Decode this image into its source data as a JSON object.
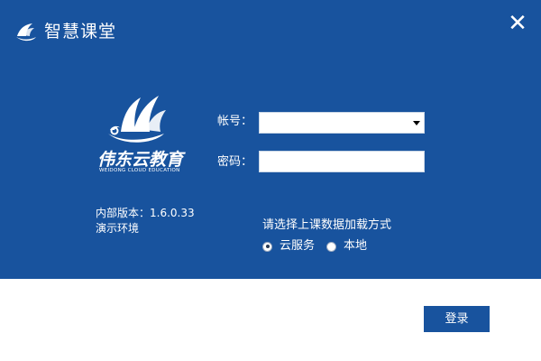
{
  "window": {
    "title": "智慧课堂",
    "close_glyph": "✕",
    "icons": {
      "app": "app-logo-icon",
      "close": "close-icon"
    }
  },
  "brand": {
    "name": "伟东云教育",
    "subtitle": "WEIDONG CLOUD EDUCATION",
    "logo_icon": "sail-logo-icon"
  },
  "version_info": {
    "line1": "内部版本：1.6.0.33",
    "line2": "演示环境"
  },
  "form": {
    "account_label": "帐号：",
    "account_value": "",
    "password_label": "密码：",
    "password_value": "",
    "dropdown_icon": "chevron-down-icon"
  },
  "load_mode": {
    "prompt": "请选择上课数据加载方式",
    "options": [
      {
        "label": "云服务",
        "selected": true
      },
      {
        "label": "本地",
        "selected": false
      }
    ]
  },
  "actions": {
    "login_label": "登录"
  },
  "colors": {
    "panel_blue": "#18539e",
    "button_blue": "#18539e",
    "bottom_bg": "#ffffff",
    "text_light": "#ffffff"
  }
}
